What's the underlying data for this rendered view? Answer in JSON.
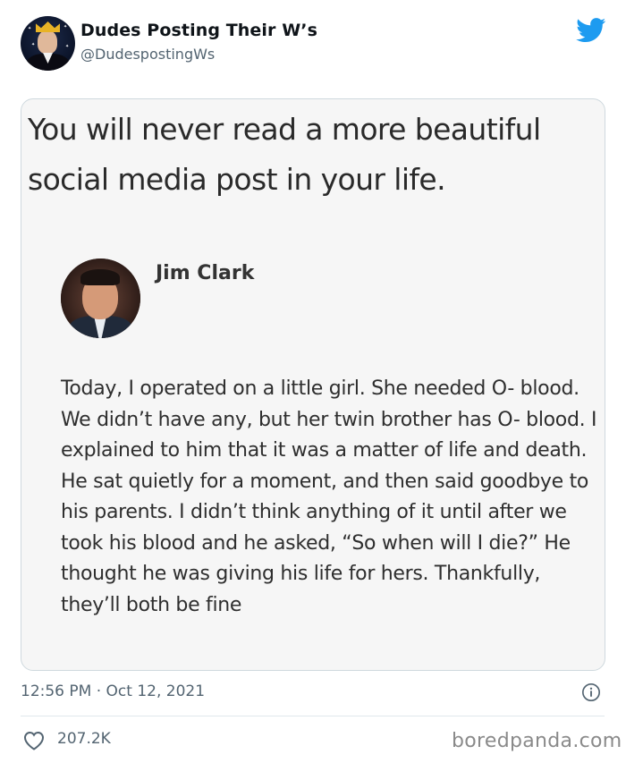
{
  "tweet": {
    "display_name": "Dudes Posting Their W’s",
    "handle": "@DudespostingWs",
    "timestamp": "12:56 PM · Oct 12, 2021",
    "likes": "207.2K"
  },
  "embedded_post": {
    "caption": "You will never read a more beautiful social media post in your life.",
    "author": "Jim Clark",
    "body": "Today, I operated on a little girl. She needed O- blood. We didn’t have any, but her twin brother has O- blood. I explained to him that it was a matter of life and death. He sat quietly for a moment, and then said goodbye to his parents. I didn’t think anything of it until after we took his blood and he asked, “So when will I die?” He thought he was giving his life for hers. Thankfully, they’ll both be fine"
  },
  "watermark": "boredpanda.com",
  "icons": {
    "brand": "twitter-bird-icon",
    "info": "info-icon",
    "like": "heart-icon"
  },
  "colors": {
    "twitter_blue": "#1d9bf0",
    "secondary_text": "#536471",
    "border": "#cfd9de"
  }
}
